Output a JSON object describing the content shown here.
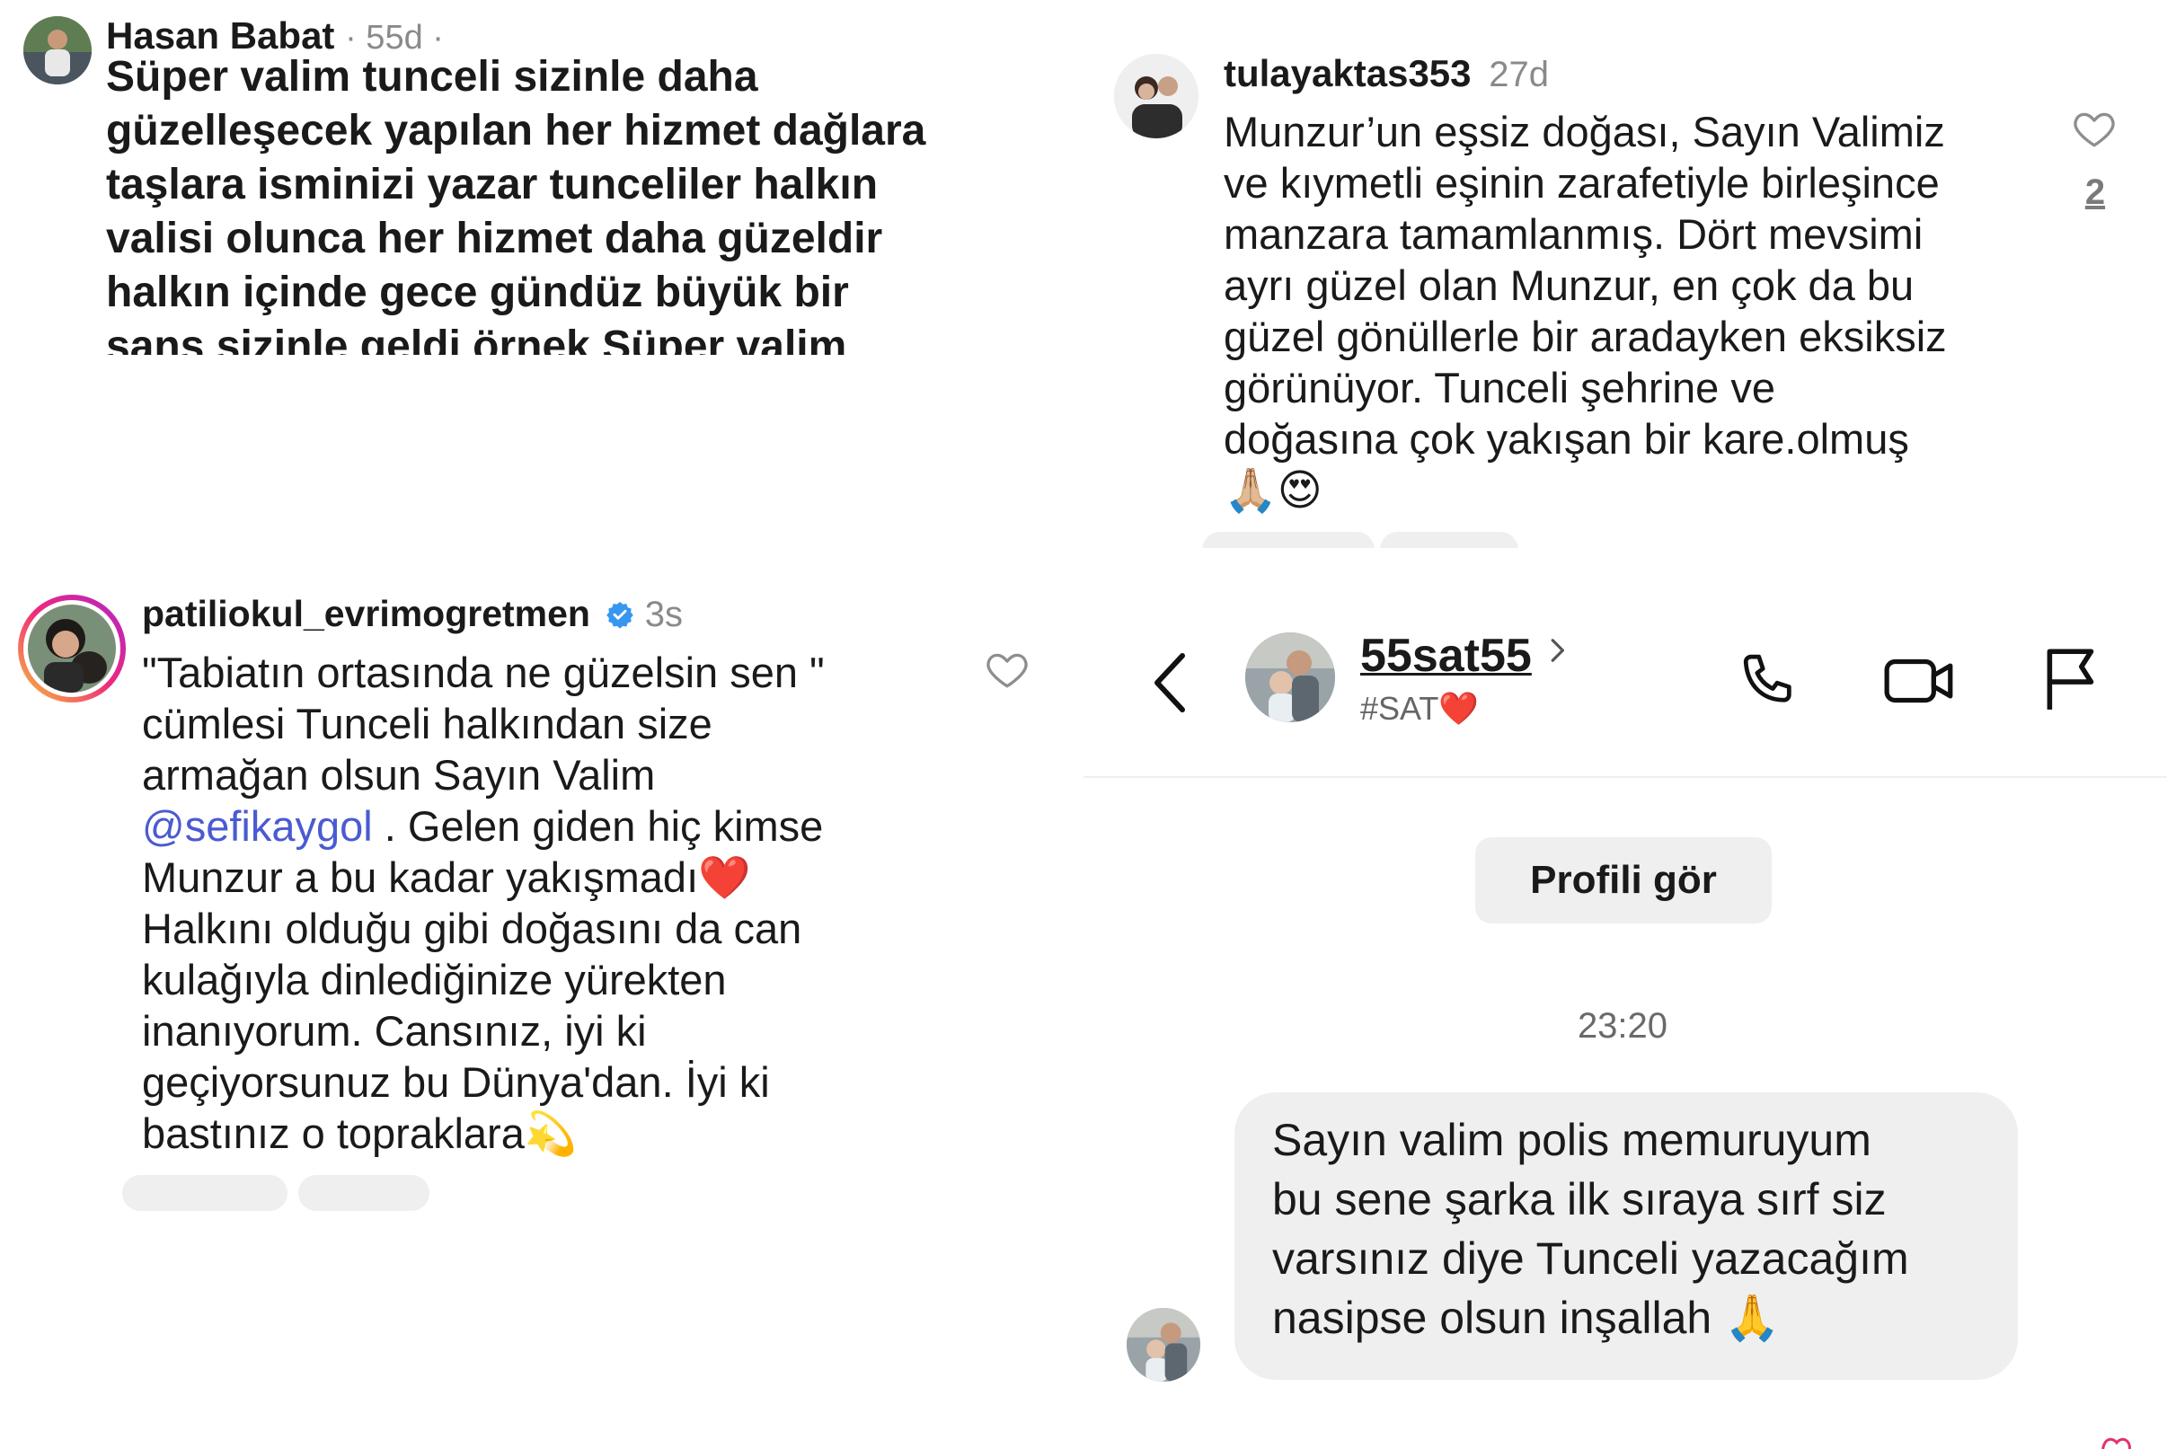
{
  "comment1": {
    "username": "Hasan Babat",
    "time": "· 55d ·",
    "text": "Süper valim tunceli sizinle daha\ngüzelleşecek yapılan her hizmet dağlara\ntaşlara isminizi yazar tunceliler  halkın\nvalisi olunca her hizmet daha güzeldir\nhalkın içinde gece gündüz büyük bir\nşans sizinle  geldi örnek Süper valim\nALLAH sağlık güzel uzun ömürler versin\nsize ve ailenize saygılar"
  },
  "comment2": {
    "username": "tulayaktas353",
    "time": "27d",
    "text": "Munzur’un eşsiz doğası, Sayın Valimiz\nve kıymetli eşinin zarafetiyle birleşince\nmanzara tamamlanmış. Dört mevsimi\nayrı güzel olan Munzur, en çok da bu\ngüzel gönüllerle bir aradayken eksiksiz\ngörünüyor. Tunceli şehrine  ve\ndoğasına çok yakışan bir kare.olmuş",
    "emoji": "🙏🏼😍",
    "like_count": "2"
  },
  "comment3": {
    "username": "patiliokul_evrimogretmen",
    "time": "3s",
    "text_line1": "\"Tabiatın ortasında ne güzelsin sen \"",
    "text_line2": "cümlesi  Tunceli halkından size",
    "text_line3": "armağan olsun Sayın Valim",
    "mention": "@sefikaygol",
    "text_after_mention": " . Gelen giden hiç kimse",
    "text_rest": "Munzur a bu kadar yakışmadı❤️\nHalkını olduğu gibi doğasını da can\nkulağıyla dinlediğinize yürekten\ninanıyorum. Cansınız, iyi ki\ngeçiyorsunuz bu Dünya'dan. İyi ki\nbastınız o topraklara💫"
  },
  "dm": {
    "username": "55sat55",
    "subtitle": "#SAT❤️",
    "profile_button": "Profili gör",
    "timestamp": "23:20",
    "message": "Sayın valim polis memuruyum\nbu sene şarka ilk sıraya sırf siz\nvarsınız diye Tunceli yazacağım\nnasipse olsun inşallah 🙏"
  },
  "icons": {
    "heart": "heart-outline-icon",
    "back": "chevron-left-icon",
    "call": "phone-icon",
    "video": "video-camera-icon",
    "report": "flag-icon",
    "verified": "verified-badge-icon",
    "verified_color": "#3797f0",
    "mention_color": "#4a5bd1"
  }
}
